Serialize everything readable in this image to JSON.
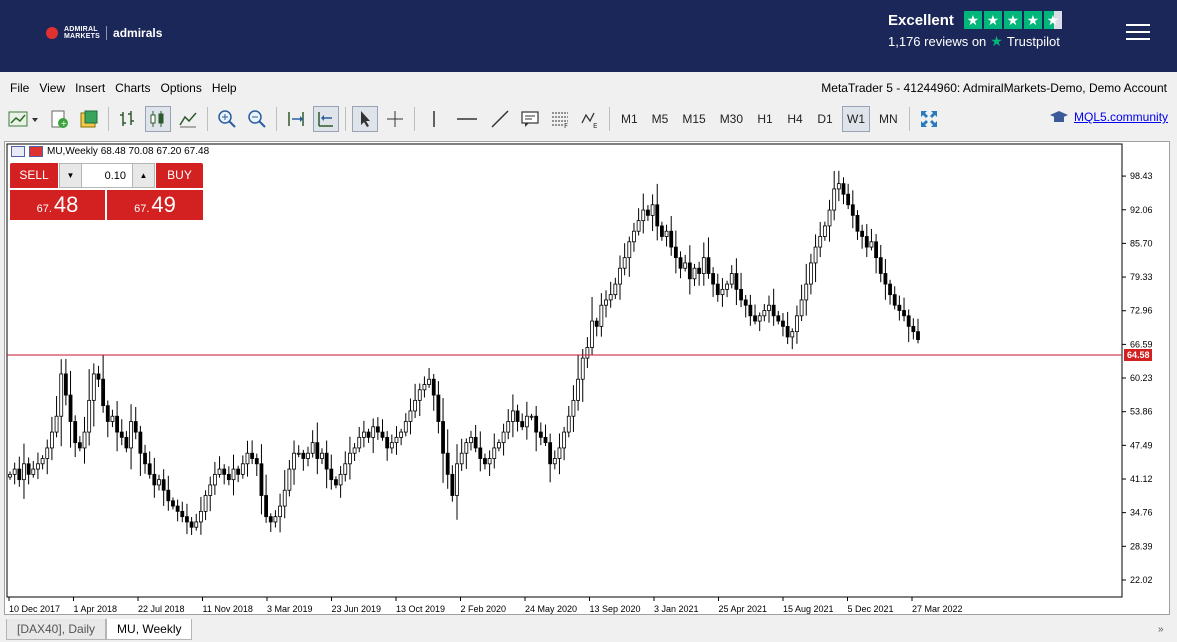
{
  "banner": {
    "logo_small": "ADMIRAL\nMARKETS",
    "logo_brand": "admirals",
    "trustpilot_rating": "Excellent",
    "trustpilot_reviews": "1,176 reviews on",
    "trustpilot_name": "Trustpilot",
    "trustpilot_stars": 4.5
  },
  "menu": {
    "items": [
      "File",
      "View",
      "Insert",
      "Charts",
      "Options",
      "Help"
    ],
    "window_title": "MetaTrader 5 - 41244960: AdmiralMarkets-Demo, Demo Account"
  },
  "toolbar": {
    "timeframes": [
      "M1",
      "M5",
      "M15",
      "M30",
      "H1",
      "H4",
      "D1",
      "W1",
      "MN"
    ],
    "active_timeframe": "W1",
    "mql5_label": "MQL5.community"
  },
  "chart": {
    "symbol_header": "MU,Weekly  68.48 70.08 67.20 67.48",
    "sell_label": "SELL",
    "buy_label": "BUY",
    "lot": "0.10",
    "sell_price_small": "67.",
    "sell_price_big": "48",
    "buy_price_small": "67.",
    "buy_price_big": "49",
    "price_line_label": "64.58"
  },
  "chart_data": {
    "type": "candlestick",
    "symbol": "MU",
    "timeframe": "Weekly",
    "y_ticks": [
      "98.43",
      "92.06",
      "85.70",
      "79.33",
      "72.96",
      "66.59",
      "60.23",
      "53.86",
      "47.49",
      "41.12",
      "34.76",
      "28.39",
      "22.02"
    ],
    "x_ticks": [
      "10 Dec 2017",
      "1 Apr 2018",
      "22 Jul 2018",
      "11 Nov 2018",
      "3 Mar 2019",
      "23 Jun 2019",
      "13 Oct 2019",
      "2 Feb 2020",
      "24 May 2020",
      "13 Sep 2020",
      "3 Jan 2021",
      "25 Apr 2021",
      "15 Aug 2021",
      "5 Dec 2021",
      "27 Mar 2022"
    ],
    "ylim": [
      18.8,
      104.5
    ],
    "price_line": 64.58,
    "close_series": [
      42,
      43,
      41,
      44,
      42,
      43,
      44,
      45,
      47,
      50,
      53,
      61,
      57,
      52,
      48,
      47,
      50,
      56,
      61,
      60,
      55,
      52,
      53,
      50,
      49,
      47,
      52,
      50,
      46,
      44,
      42,
      40,
      41,
      39,
      37,
      36,
      35,
      34,
      33,
      32,
      33,
      35,
      38,
      40,
      42,
      43,
      42,
      41,
      43,
      42,
      44,
      46,
      45,
      44,
      38,
      34,
      33,
      34,
      36,
      39,
      43,
      46,
      46,
      45,
      46,
      48,
      45,
      46,
      43,
      41,
      40,
      42,
      44,
      46,
      47,
      49,
      50,
      49,
      51,
      50,
      49,
      47,
      48,
      49,
      50,
      52,
      54,
      56,
      58,
      59,
      60,
      57,
      52,
      46,
      42,
      38,
      44,
      46,
      48,
      49,
      47,
      45,
      44,
      45,
      47,
      48,
      50,
      52,
      54,
      52,
      51,
      53,
      53,
      50,
      49,
      48,
      44,
      45,
      47,
      50,
      53,
      56,
      60,
      64,
      66,
      71,
      70,
      74,
      75,
      76,
      78,
      81,
      83,
      86,
      88,
      90,
      92,
      91,
      93,
      89,
      87,
      88,
      85,
      83,
      81,
      82,
      79,
      81,
      80,
      83,
      80,
      78,
      76,
      77,
      78,
      80,
      77,
      75,
      74,
      72,
      71,
      72,
      73,
      74,
      72,
      71,
      70,
      68,
      69,
      72,
      75,
      78,
      82,
      85,
      87,
      89,
      92,
      96,
      97,
      95,
      93,
      91,
      88,
      87,
      85,
      86,
      83,
      80,
      78,
      76,
      74,
      73,
      72,
      70,
      69,
      67.5
    ]
  }
}
